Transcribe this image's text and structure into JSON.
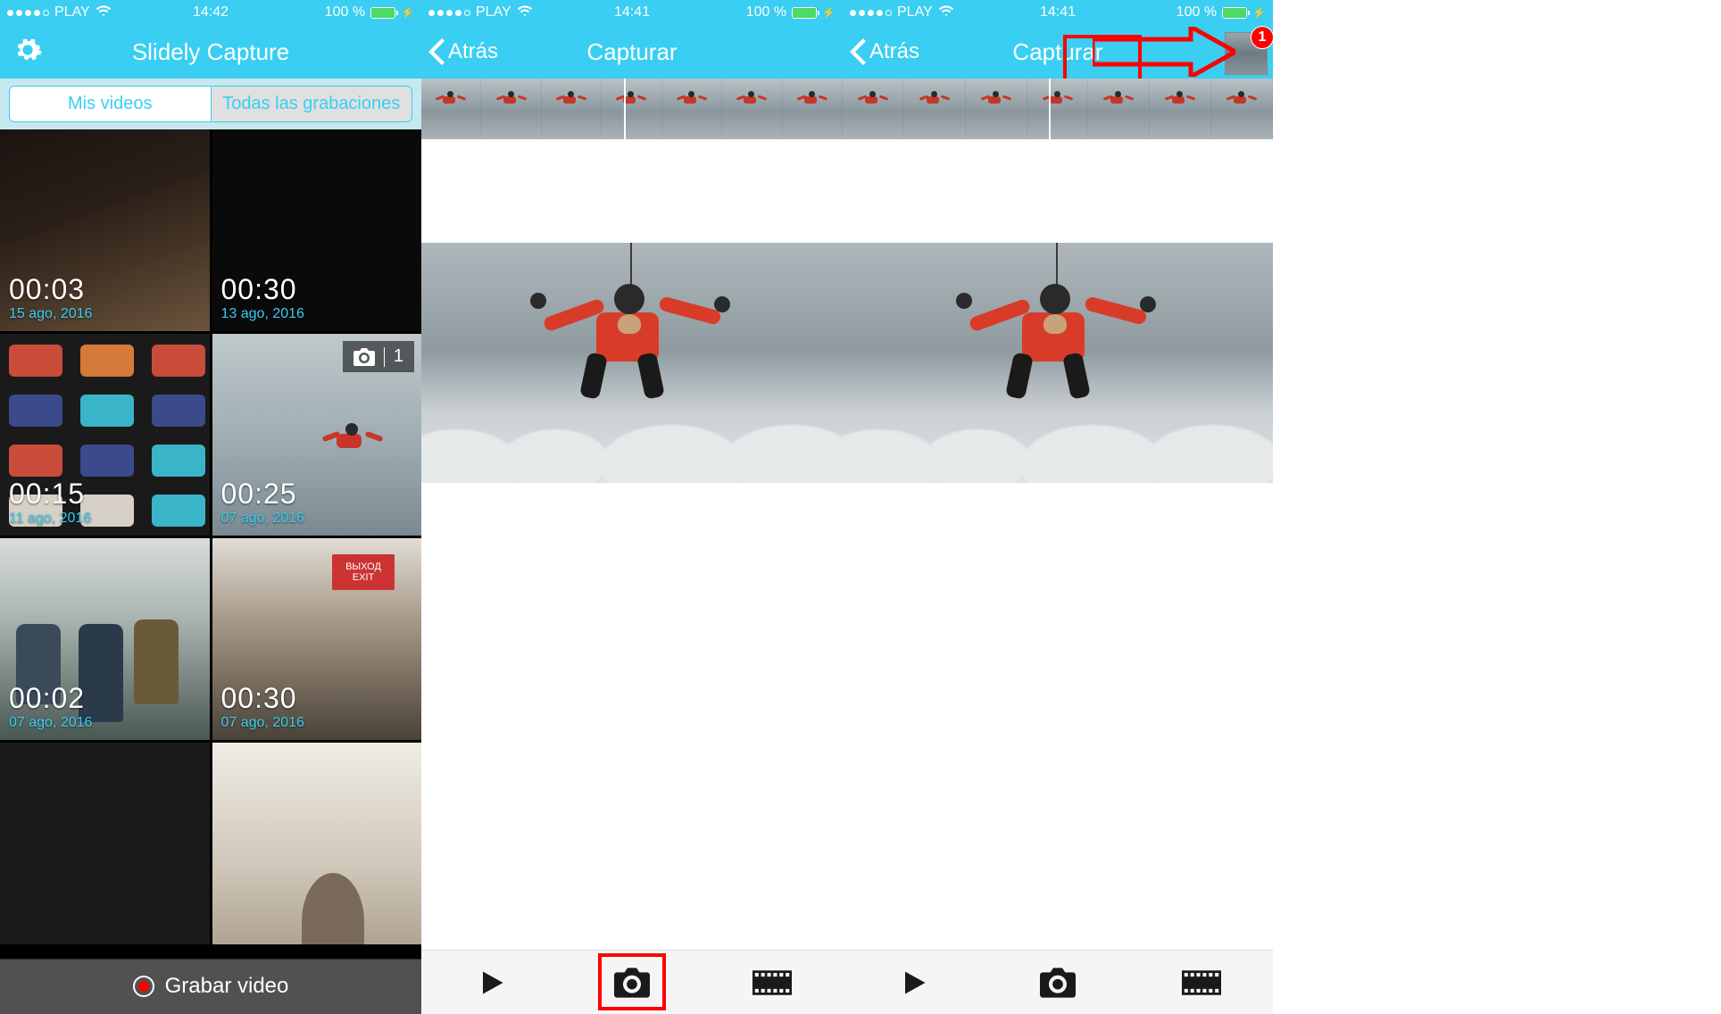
{
  "statusbar": {
    "carrier": "PLAY",
    "battery_pct": "100 %",
    "times": [
      "14:42",
      "14:41",
      "14:41"
    ]
  },
  "screen0": {
    "title": "Slidely Capture",
    "tab_left": "Mis videos",
    "tab_right": "Todas las grabaciones",
    "record_label": "Grabar video",
    "photo_count": "1",
    "items": [
      {
        "dur": "00:03",
        "date": "15 ago, 2016"
      },
      {
        "dur": "00:30",
        "date": "13 ago, 2016"
      },
      {
        "dur": "00:15",
        "date": "11 ago, 2016"
      },
      {
        "dur": "00:25",
        "date": "07 ago, 2016"
      },
      {
        "dur": "00:02",
        "date": "07 ago, 2016"
      },
      {
        "dur": "00:30",
        "date": "07 ago, 2016"
      }
    ],
    "exit_sign_top": "ВЫХОД",
    "exit_sign_bottom": "EXIT"
  },
  "screen1": {
    "back": "Atrás",
    "title": "Capturar"
  },
  "screen2": {
    "back": "Atrás",
    "title": "Capturar",
    "badge": "1"
  }
}
